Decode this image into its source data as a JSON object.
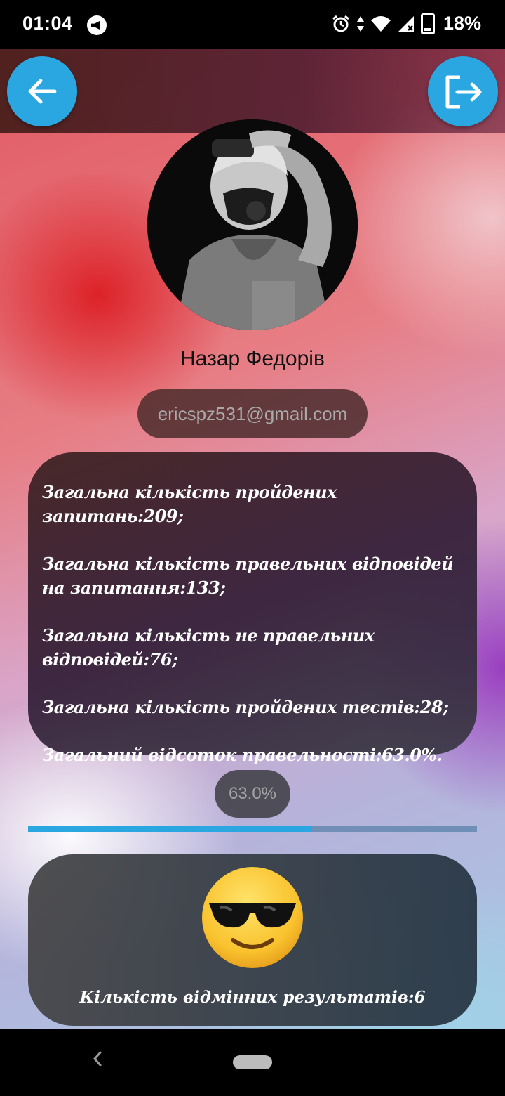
{
  "status_bar": {
    "time": "01:04",
    "battery": "18%",
    "icons": [
      "megaphone-icon",
      "alarm-icon",
      "data-arrows-icon",
      "wifi-icon",
      "signal-icon",
      "battery-icon"
    ]
  },
  "app_bar": {
    "back_icon": "arrow-left-icon",
    "logout_icon": "logout-icon",
    "accent_color": "#2aa7e0"
  },
  "profile": {
    "name": "Назар Федорів",
    "email": "ericspz531@gmail.com"
  },
  "stats": [
    "Загальна кількість пройдених запитань:209;",
    "Загальна кількість правельних відповідей на запитання:133;",
    "Загальна кількість не правельних відповідей:76;",
    "Загальна кількість пройдених тестів:28;",
    "Загальний відсоток правельності:63.0%."
  ],
  "progress": {
    "label": "63.0%",
    "value": 0.63
  },
  "result": {
    "emoji": "sunglasses-face-icon",
    "label": "Кількість відмінних результатів:6"
  }
}
